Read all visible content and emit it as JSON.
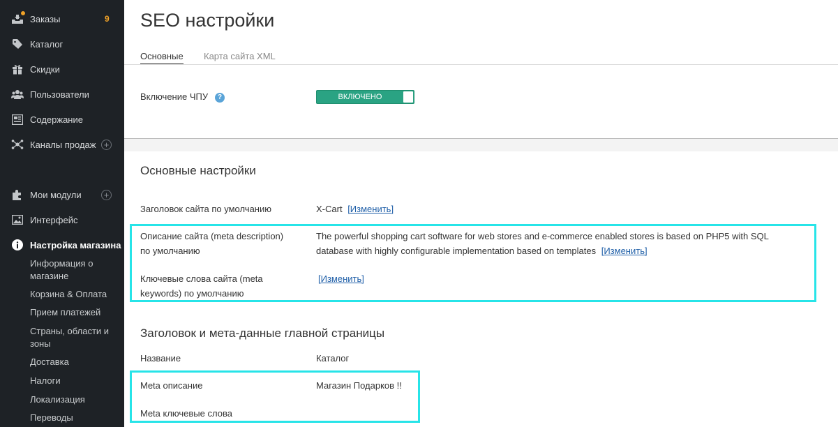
{
  "sidebar": {
    "items": [
      {
        "label": "Заказы",
        "badge": "9"
      },
      {
        "label": "Каталог"
      },
      {
        "label": "Скидки"
      },
      {
        "label": "Пользователи"
      },
      {
        "label": "Содержание"
      },
      {
        "label": "Каналы продаж"
      },
      {
        "label": "Мои модули"
      },
      {
        "label": "Интерфейс"
      },
      {
        "label": "Настройка магазина"
      }
    ],
    "subitems": [
      "Информация о магазине",
      "Корзина & Оплата",
      "Прием платежей",
      "Страны, области и зоны",
      "Доставка",
      "Налоги",
      "Локализация",
      "Переводы"
    ]
  },
  "page": {
    "title": "SEO настройки",
    "tabs": [
      "Основные",
      "Карта сайта XML"
    ]
  },
  "seo_urls": {
    "label": "Включение ЧПУ",
    "help": "?",
    "toggle_label": "ВКЛЮЧЕНО",
    "toggle_on": true
  },
  "main_settings": {
    "title": "Основные настройки",
    "site_title": {
      "label": "Заголовок сайта по умолчанию",
      "value": "X-Cart",
      "link": "[Изменить]"
    },
    "meta_description": {
      "label_line1": "Описание сайта (meta description)",
      "label_line2": "по умолчанию",
      "value_line1": "The powerful shopping cart software for web stores and e-commerce enabled stores is based on PHP5 with SQL",
      "value_line2": "database with highly configurable implementation based on templates",
      "link": "[Изменить]"
    },
    "meta_keywords": {
      "label_line1": "Ключевые слова сайта (meta",
      "label_line2": "keywords) по умолчанию",
      "link": "[Изменить]"
    }
  },
  "home_meta": {
    "title": "Заголовок и мета-данные главной страницы",
    "name_label": "Название",
    "name_value": "Каталог",
    "meta_desc_label": "Meta описание",
    "meta_desc_value": "Магазин Подарков !!",
    "meta_keywords_label": "Meta ключевые слова"
  },
  "colors": {
    "sidebar_bg": "#1e2226",
    "toggle_on": "#2aa383",
    "highlight": "#27e4e8",
    "link": "#1f5fa8",
    "badge": "#f0a228"
  }
}
